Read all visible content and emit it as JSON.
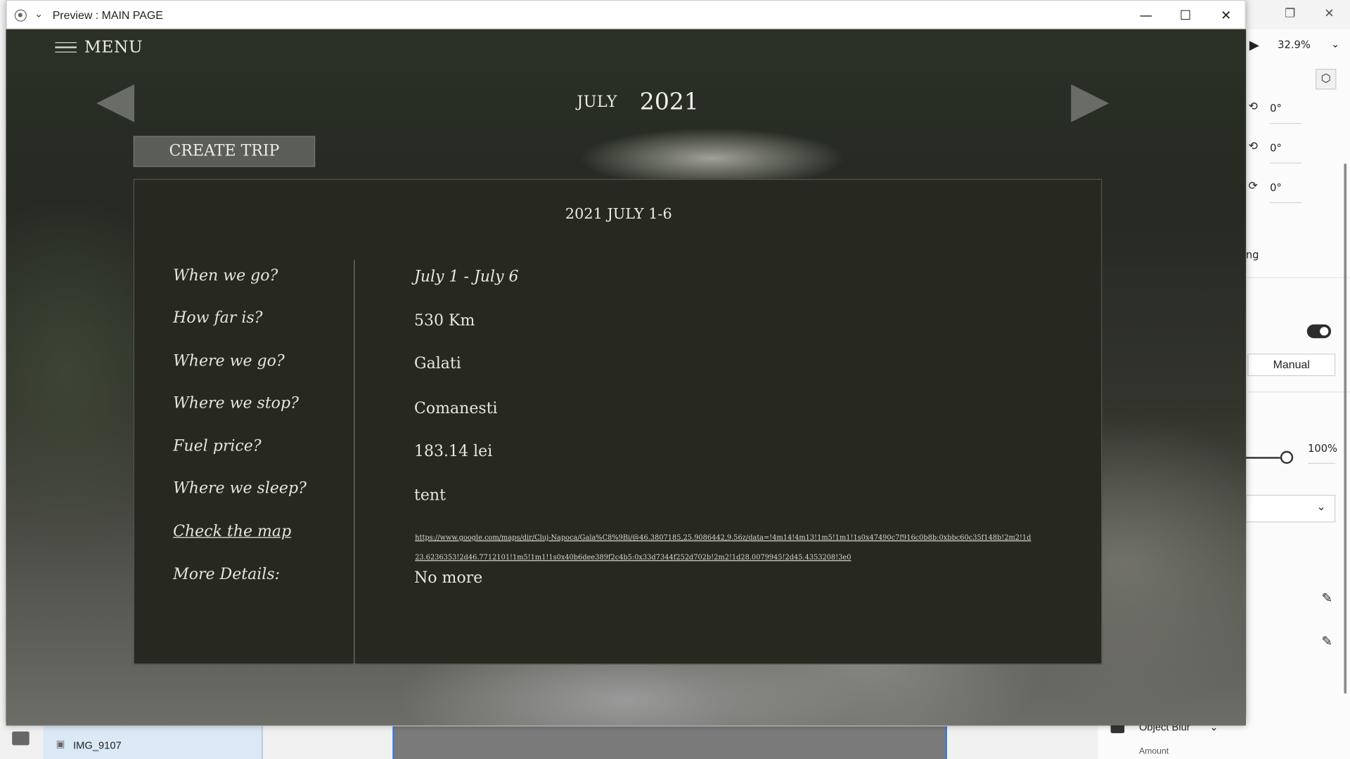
{
  "window": {
    "title": "Preview : MAIN PAGE"
  },
  "nav": {
    "menu_label": "MENU",
    "month": "JULY",
    "year": "2021",
    "create_trip_label": "CREATE TRIP"
  },
  "trip": {
    "title": "2021 JULY 1-6",
    "rows": [
      {
        "question": "When we go?",
        "answer": "July 1 - July 6"
      },
      {
        "question": "How far is?",
        "answer": "530 Km"
      },
      {
        "question": "Where we go?",
        "answer": "Galati"
      },
      {
        "question": "Where we stop?",
        "answer": "Comanesti"
      },
      {
        "question": "Fuel price?",
        "answer": "183.14 lei"
      },
      {
        "question": "Where we sleep?",
        "answer": "tent"
      },
      {
        "question": "Check the map",
        "answer": "https://www.google.com/maps/dir/Cluj-Napoca/Gala%C8%9Bi/@46.3807185,25.9086442,9.56z/data=!4m14!4m13!1m5!1m1!1s0x47490c7f916c0b8b:0xbbc60c35f148b!2m2!1d23.6236353!2d46.7712101!1m5!1m1!1s0x40b6dee389f2c4b5:0x33d7344f252d702b!2m2!1d28.0079945!2d45.4353208!3e0"
      },
      {
        "question": "More Details:",
        "answer": "No more"
      }
    ]
  },
  "editor": {
    "zoom": "32.9%",
    "rotation_1": "0°",
    "rotation_2": "0°",
    "rotation_3": "0°",
    "partial_label": "ng",
    "mode": "Manual",
    "opacity": "100%",
    "file_name": "IMG_9107",
    "effect_label": "Object Blur",
    "amount_label": "Amount"
  }
}
